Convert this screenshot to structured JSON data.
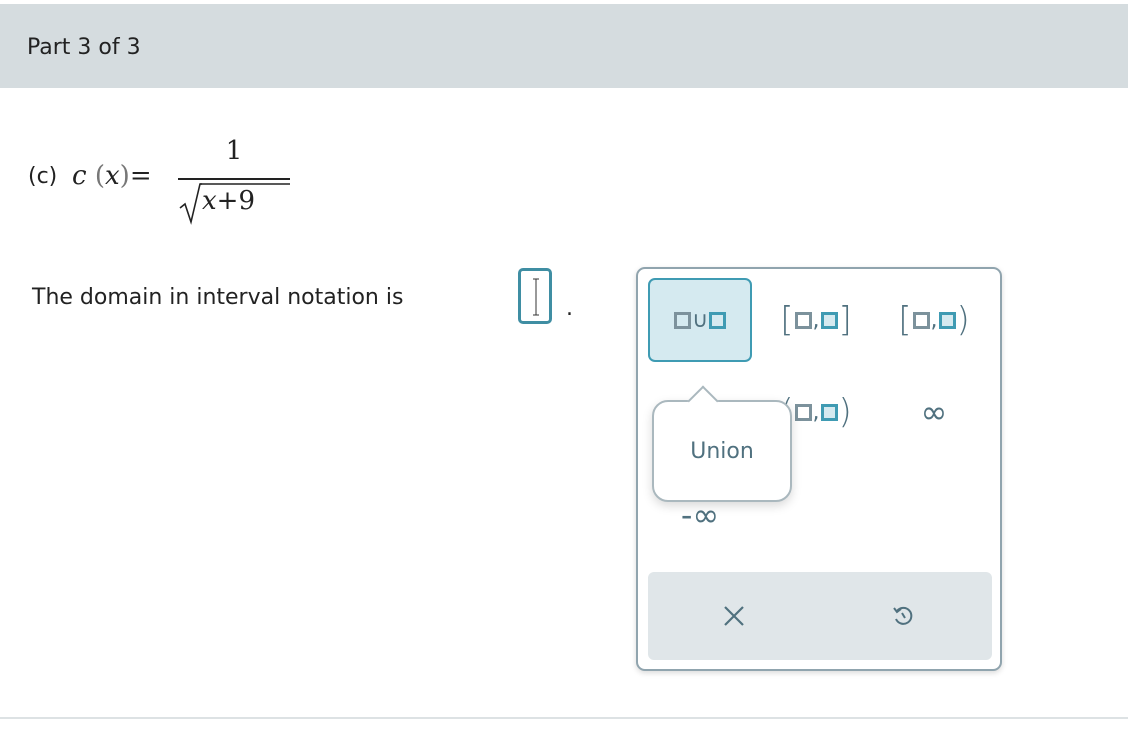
{
  "header": {
    "title": "Part 3 of 3"
  },
  "problem": {
    "label": "(c)",
    "func_name": "c",
    "var": "x",
    "equals": "=",
    "numerator": "1",
    "denominator_var": "x",
    "denominator_rest": "+9"
  },
  "prompt": {
    "text": "The domain in interval notation is",
    "period": "."
  },
  "palette": {
    "keys": [
      {
        "name": "union",
        "symbol": "∪"
      },
      {
        "name": "closed-interval",
        "left": "[",
        "comma": ",",
        "right": "]"
      },
      {
        "name": "half-open-interval",
        "left": "[",
        "comma": ",",
        "right": ")"
      },
      {
        "name": "open-interval",
        "left": "(",
        "comma": ",",
        "right": ")"
      },
      {
        "name": "infinity",
        "symbol": "∞"
      },
      {
        "name": "negative-infinity",
        "symbol": "-∞"
      }
    ],
    "tooltip": "Union",
    "active_key": "union",
    "toolbar": {
      "clear_icon": "×",
      "undo_icon": "undo-arrow-icon"
    }
  },
  "colors": {
    "accent": "#3f9bb3",
    "header_bg": "#d5dcdf",
    "key_text": "#50717f"
  }
}
